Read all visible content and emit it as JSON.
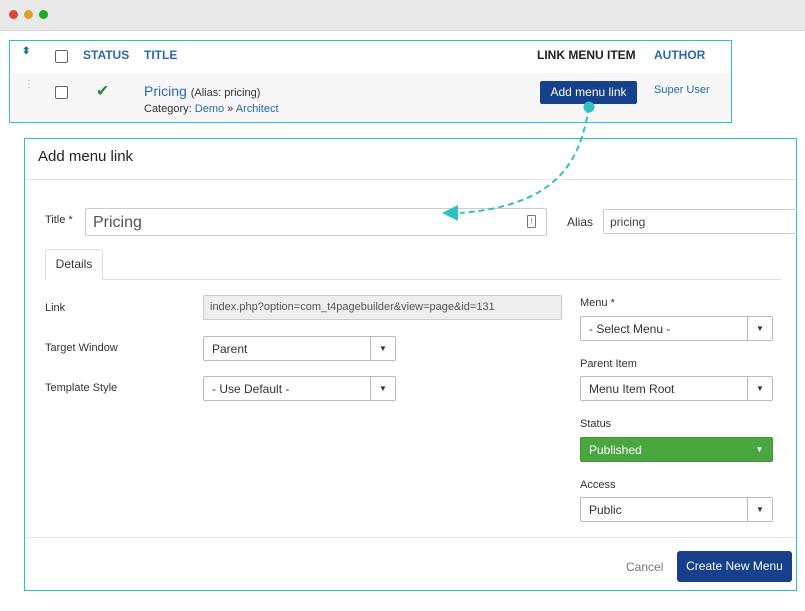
{
  "window": {
    "dots": [
      "#e0443e",
      "#dea123",
      "#1aab29"
    ]
  },
  "list": {
    "headers": {
      "status": "STATUS",
      "title": "TITLE",
      "link_menu_item": "LINK MENU ITEM",
      "author": "AUTHOR"
    },
    "row": {
      "title": "Pricing",
      "alias": "(Alias: pricing)",
      "category_prefix": "Category:",
      "category": "Demo",
      "separator": "»",
      "subcategory": "Architect",
      "button": "Add menu link",
      "author": "Super User"
    }
  },
  "modal": {
    "title": "Add menu link",
    "title_label": "Title *",
    "title_value": "Pricing",
    "alias_label": "Alias",
    "alias_value": "pricing",
    "tab": "Details",
    "link_label": "Link",
    "link_value": "index.php?option=com_t4pagebuilder&view=page&id=131",
    "target_label": "Target Window",
    "target_value": "Parent",
    "template_label": "Template Style",
    "template_value": "- Use Default -",
    "menu_label": "Menu *",
    "menu_value": "- Select Menu -",
    "parent_label": "Parent Item",
    "parent_value": "Menu Item Root",
    "status_label": "Status",
    "status_value": "Published",
    "access_label": "Access",
    "access_value": "Public",
    "cancel": "Cancel",
    "create": "Create New Menu"
  },
  "colors": {
    "accent": "#17408c",
    "teal": "#2fc0c3",
    "link": "#2b6aa8",
    "published": "#4aa63f"
  },
  "icons": {
    "sort": "sort-icon",
    "check": "check-icon",
    "drag": "drag-handle-icon",
    "field": "field-info-icon",
    "caret": "caret-down-icon"
  }
}
